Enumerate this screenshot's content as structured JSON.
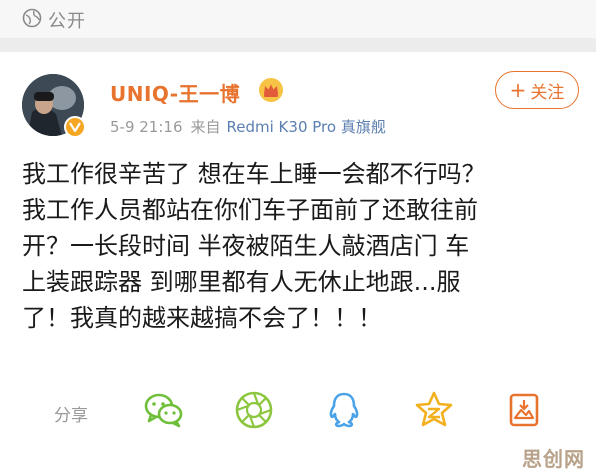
{
  "privacy": {
    "icon": "globe-icon",
    "label": "公开"
  },
  "author": {
    "name": "UNIQ-王一博",
    "badge_icon": "crown-icon",
    "verified_icon": "verified-icon",
    "time": "5-9 21:16",
    "source_prefix": "来自",
    "device": "Redmi K30 Pro 真旗舰"
  },
  "follow": {
    "plus": "+",
    "label": "关注"
  },
  "post": {
    "lines": [
      "我工作很辛苦了 想在车上睡一会都不行吗？",
      "我工作人员都站在你们车子面前了还敢往前",
      "开？一长段时间 半夜被陌生人敲酒店门 车",
      "上装跟踪器 到哪里都有人无休止地跟...服",
      "了！我真的越来越搞不会了！！！"
    ]
  },
  "share": {
    "label": "分享",
    "targets": [
      "wechat-icon",
      "moments-icon",
      "qq-icon",
      "qzone-icon",
      "save-image-icon"
    ]
  },
  "watermark": "思创网",
  "colors": {
    "accent": "#e8732e",
    "link": "#5b7fb0",
    "icon_green": "#6fbf3a",
    "icon_blue": "#4aa3e8",
    "icon_yellow": "#f2b01e",
    "icon_orange": "#e8732e"
  }
}
